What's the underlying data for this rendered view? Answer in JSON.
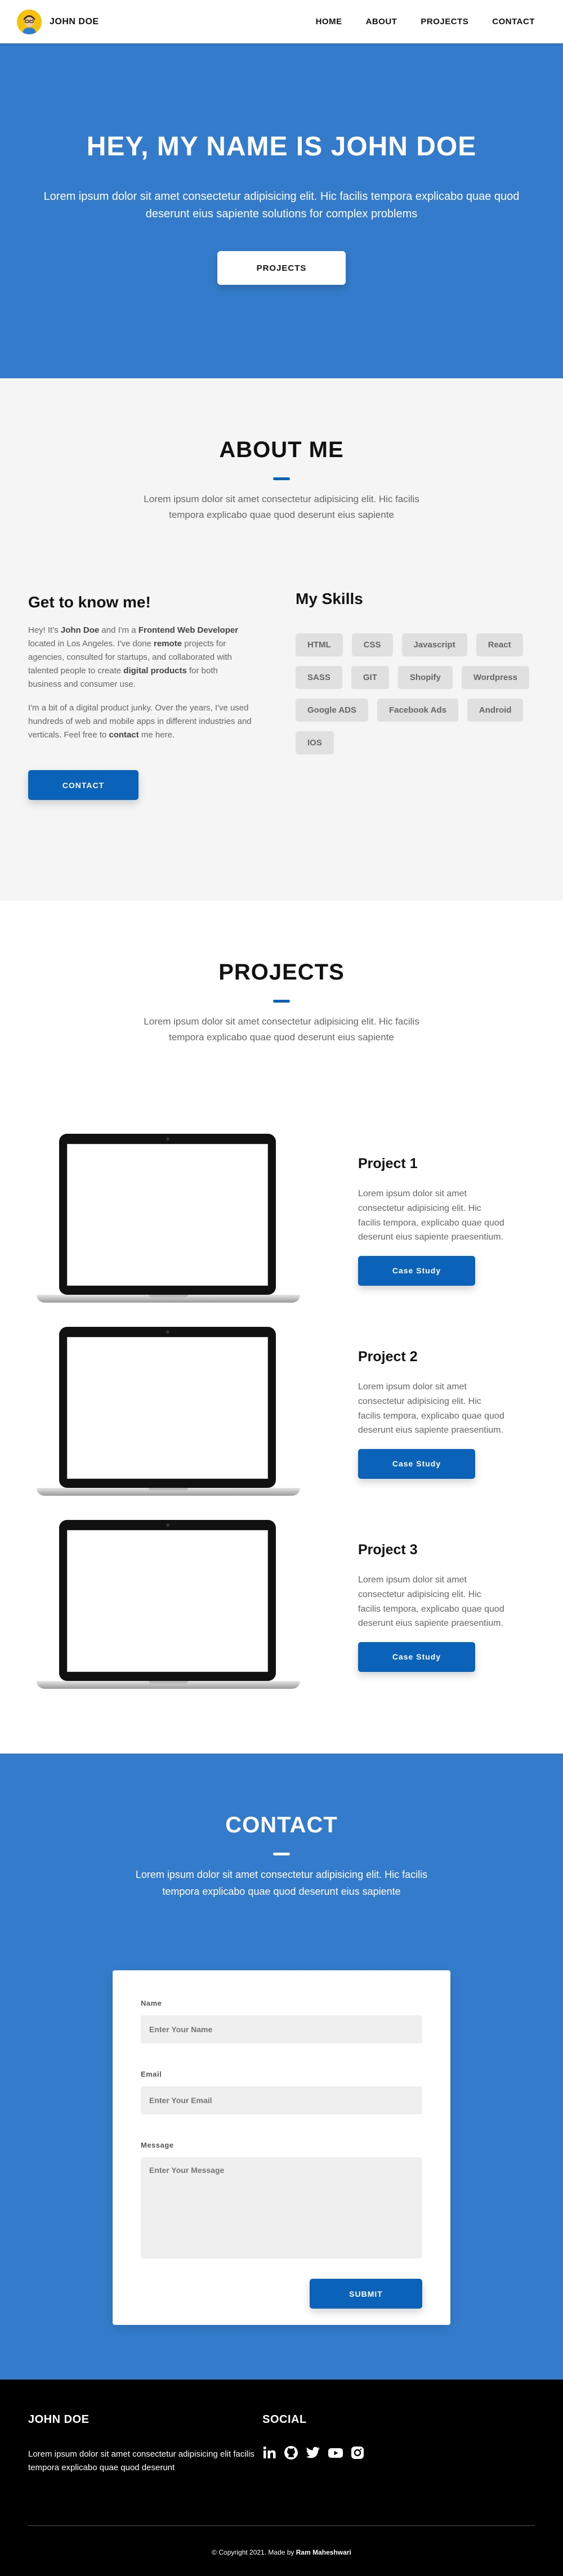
{
  "header": {
    "brand_name": "JOHN DOE",
    "nav": [
      "HOME",
      "ABOUT",
      "PROJECTS",
      "CONTACT"
    ]
  },
  "hero": {
    "title": "HEY, MY NAME IS JOHN DOE",
    "subtitle": "Lorem ipsum dolor sit amet consectetur adipisicing elit. Hic facilis tempora explicabo quae quod deserunt eius sapiente solutions for complex problems",
    "button": "PROJECTS"
  },
  "about": {
    "title": "ABOUT ME",
    "subtitle": "Lorem ipsum dolor sit amet consectetur adipisicing elit. Hic facilis tempora explicabo quae quod deserunt eius sapiente",
    "left": {
      "heading": "Get to know me!",
      "p1": {
        "t1": "Hey! It's ",
        "b1": "John Doe",
        "t2": " and I'm a ",
        "b2": "Frontend Web Developer",
        "t3": " located in Los Angeles. I've done ",
        "b3": "remote",
        "t4": " projects for agencies, consulted for startups, and collaborated with talented people to create ",
        "b4": "digital products",
        "t5": " for both business and consumer use."
      },
      "p2": {
        "t1": "I'm a bit of a digital product junky. Over the years, I've used hundreds of web and mobile apps in different industries and verticals. Feel free to ",
        "b1": "contact",
        "t2": " me here."
      },
      "button": "CONTACT"
    },
    "right": {
      "heading": "My Skills",
      "skills": [
        "HTML",
        "CSS",
        "Javascript",
        "React",
        "SASS",
        "GIT",
        "Shopify",
        "Wordpress",
        "Google ADS",
        "Facebook Ads",
        "Android",
        "IOS"
      ]
    }
  },
  "projects": {
    "title": "PROJECTS",
    "subtitle": "Lorem ipsum dolor sit amet consectetur adipisicing elit. Hic facilis tempora explicabo quae quod deserunt eius sapiente",
    "items": [
      {
        "title": "Project 1",
        "desc": "Lorem ipsum dolor sit amet consectetur adipisicing elit. Hic facilis tempora, explicabo quae quod deserunt eius sapiente praesentium.",
        "button": "Case Study"
      },
      {
        "title": "Project 2",
        "desc": "Lorem ipsum dolor sit amet consectetur adipisicing elit. Hic facilis tempora, explicabo quae quod deserunt eius sapiente praesentium.",
        "button": "Case Study"
      },
      {
        "title": "Project 3",
        "desc": "Lorem ipsum dolor sit amet consectetur adipisicing elit. Hic facilis tempora, explicabo quae quod deserunt eius sapiente praesentium.",
        "button": "Case Study"
      }
    ]
  },
  "contact": {
    "title": "CONTACT",
    "subtitle": "Lorem ipsum dolor sit amet consectetur adipisicing elit. Hic facilis tempora explicabo quae quod deserunt eius sapiente",
    "form": {
      "name_label": "Name",
      "name_placeholder": "Enter Your Name",
      "email_label": "Email",
      "email_placeholder": "Enter Your Email",
      "message_label": "Message",
      "message_placeholder": "Enter Your Message",
      "submit": "SUBMIT"
    }
  },
  "footer": {
    "brand_heading": "JOHN DOE",
    "brand_text": "Lorem ipsum dolor sit amet consectetur adipisicing elit facilis tempora explicabo quae quod deserunt",
    "social_heading": "SOCIAL",
    "social_icons": [
      "linkedin-icon",
      "github-icon",
      "twitter-icon",
      "youtube-icon",
      "instagram-icon"
    ],
    "copyright_prefix": "© Copyright 2021. Made by ",
    "copyright_author": "Ram Maheshwari"
  },
  "colors": {
    "primary_blue": "#347ccb",
    "button_blue": "#0a63b8",
    "light_bg": "#f5f5f5",
    "footer_bg": "#000000"
  }
}
